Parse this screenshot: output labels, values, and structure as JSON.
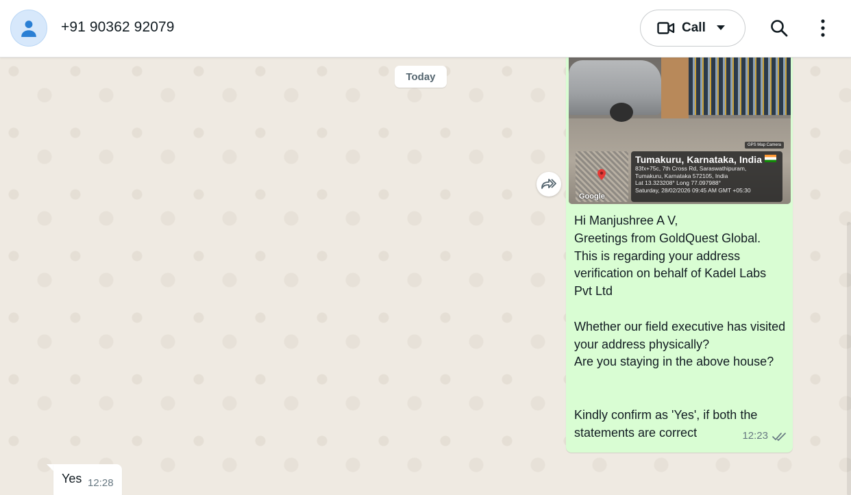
{
  "header": {
    "contact_name": "+91 90362 92079",
    "call_label": "Call",
    "avatar_icon": "person-icon",
    "video_icon": "video-camera-icon",
    "caret_icon": "caret-down-icon",
    "search_icon": "search-icon",
    "menu_icon": "more-vertical-icon"
  },
  "chat": {
    "date_chip": "Today",
    "outgoing": {
      "photo": {
        "location_title": "Tumakuru, Karnataka, India",
        "address_line1": "83fx+75c, 7th Cross Rd, Saraswathipuram,",
        "address_line2": "Tumakuru, Karnataka 572105, India",
        "coords": "Lat 13.323208° Long 77.097988°",
        "datetime": "Saturday, 28/02/2026 09:45 AM GMT +05:30",
        "map_brand": "Google",
        "camera_badge": "GPS Map Camera"
      },
      "text": "Hi Manjushree A V,\nGreetings from GoldQuest Global.\nThis is regarding your address verification on behalf of Kadel Labs Pvt Ltd\n\nWhether our field executive has visited your address physically?\nAre you staying in the above house?\n\n\nKindly confirm as 'Yes', if both the statements are correct",
      "time": "12:23",
      "status": "read"
    },
    "incoming": {
      "text": "Yes",
      "time": "12:28"
    }
  },
  "colors": {
    "outgoing_bubble": "#d9fdd3",
    "incoming_bubble": "#ffffff",
    "chat_background": "#efeae2",
    "read_ticks": "#667781"
  }
}
